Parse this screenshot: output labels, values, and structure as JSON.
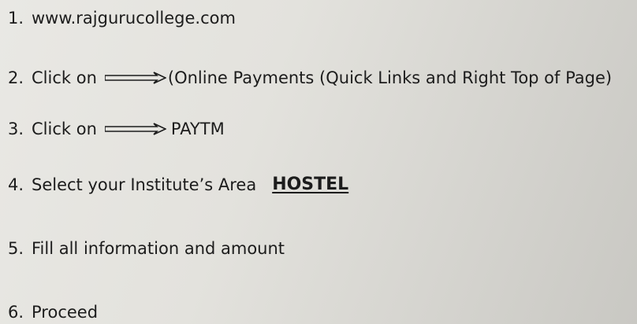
{
  "steps": [
    {
      "num": "1.",
      "text": "www.rajgurucollege.com"
    },
    {
      "num": "2.",
      "text": "Click on",
      "after": "(Online Payments (Quick Links and Right Top of Page)"
    },
    {
      "num": "3.",
      "text": "Click on",
      "after": "PAYTM"
    },
    {
      "num": "4.",
      "text": "Select your Institute’s Area",
      "highlight": "HOSTEL"
    },
    {
      "num": "5.",
      "text": "Fill all information and amount"
    },
    {
      "num": "6.",
      "text": "Proceed"
    }
  ],
  "icons": {
    "arrow": "double-arrow-right-icon"
  }
}
